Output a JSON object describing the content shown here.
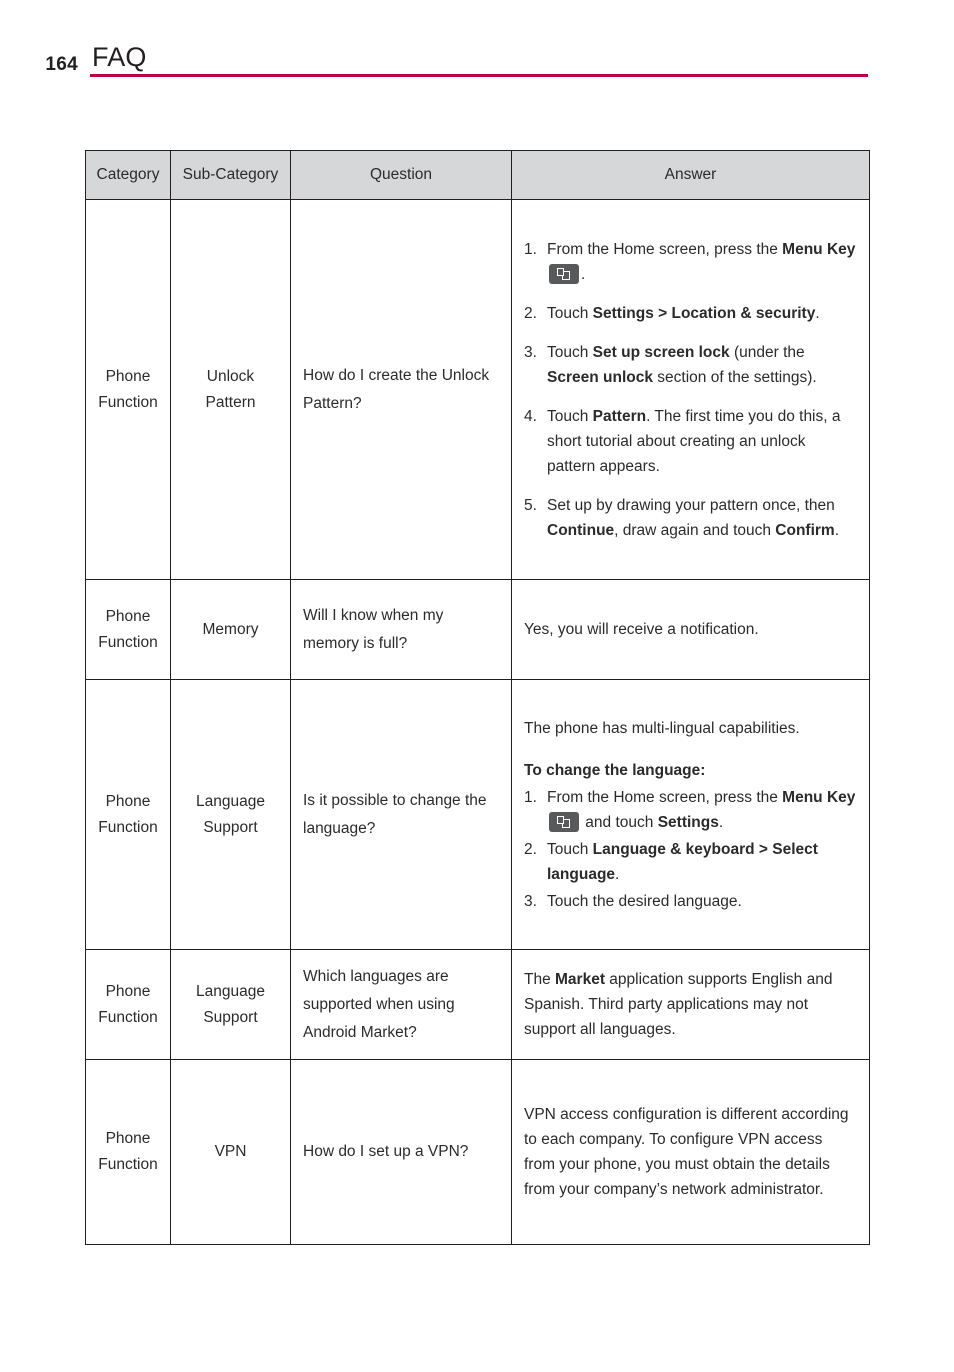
{
  "page": {
    "number": "164",
    "title": "FAQ",
    "rule_color": "#bf0044"
  },
  "table": {
    "headers": {
      "category": "Category",
      "subcategory": "Sub-Category",
      "question": "Question",
      "answer": "Answer"
    },
    "header_bg": "#d6d7d8",
    "rows": [
      {
        "category": "Phone Function",
        "subcategory": "Unlock Pattern",
        "question": "How do I create the Unlock Pattern?",
        "answer": {
          "steps": [
            {
              "pre": "From the Home screen, press the ",
              "bold1": "Menu Key",
              "icon": "menu-key-icon",
              "post": "."
            },
            {
              "pre": "Touch ",
              "bold1": "Settings > Location & security",
              "post": "."
            },
            {
              "pre": "Touch ",
              "bold1": "Set up screen lock",
              "mid": " (under the ",
              "bold2": "Screen unlock",
              "post": " section of the settings)."
            },
            {
              "pre": "Touch ",
              "bold1": "Pattern",
              "post": ". The first time you do this, a short tutorial about creating an unlock pattern appears."
            },
            {
              "pre": "Set up by drawing your pattern once, then ",
              "bold1": "Continue",
              "mid": ", draw again and touch ",
              "bold2": "Confirm",
              "post": "."
            }
          ]
        }
      },
      {
        "category": "Phone Function",
        "subcategory": "Memory",
        "question": "Will I know when my memory is full?",
        "answer": {
          "text": "Yes, you will receive a notification."
        }
      },
      {
        "category": "Phone Function",
        "subcategory": "Language Support",
        "question": "Is it possible to change the language?",
        "answer": {
          "lead": "The phone has multi-lingual capabilities.",
          "subhead": "To change the language:",
          "steps": [
            {
              "pre": "From the Home screen, press the ",
              "bold1": "Menu Key",
              "icon": "menu-key-icon",
              "mid": " and touch ",
              "bold2": "Settings",
              "post": "."
            },
            {
              "pre": "Touch ",
              "bold1": "Language & keyboard > Select language",
              "post": "."
            },
            {
              "pre": "Touch the desired language.",
              "post": ""
            }
          ]
        }
      },
      {
        "category": "Phone Function",
        "subcategory": "Language Support",
        "question": "Which languages are supported when using Android Market?",
        "answer": {
          "pre": "The ",
          "bold1": "Market",
          "post": " application supports English and Spanish. Third party applications may not support all languages."
        }
      },
      {
        "category": "Phone Function",
        "subcategory": "VPN",
        "question": "How do I set up a VPN?",
        "answer": {
          "text": "VPN access configuration is different according to each company. To configure VPN access from your phone, you must obtain the details from your company’s network administrator."
        }
      }
    ]
  }
}
